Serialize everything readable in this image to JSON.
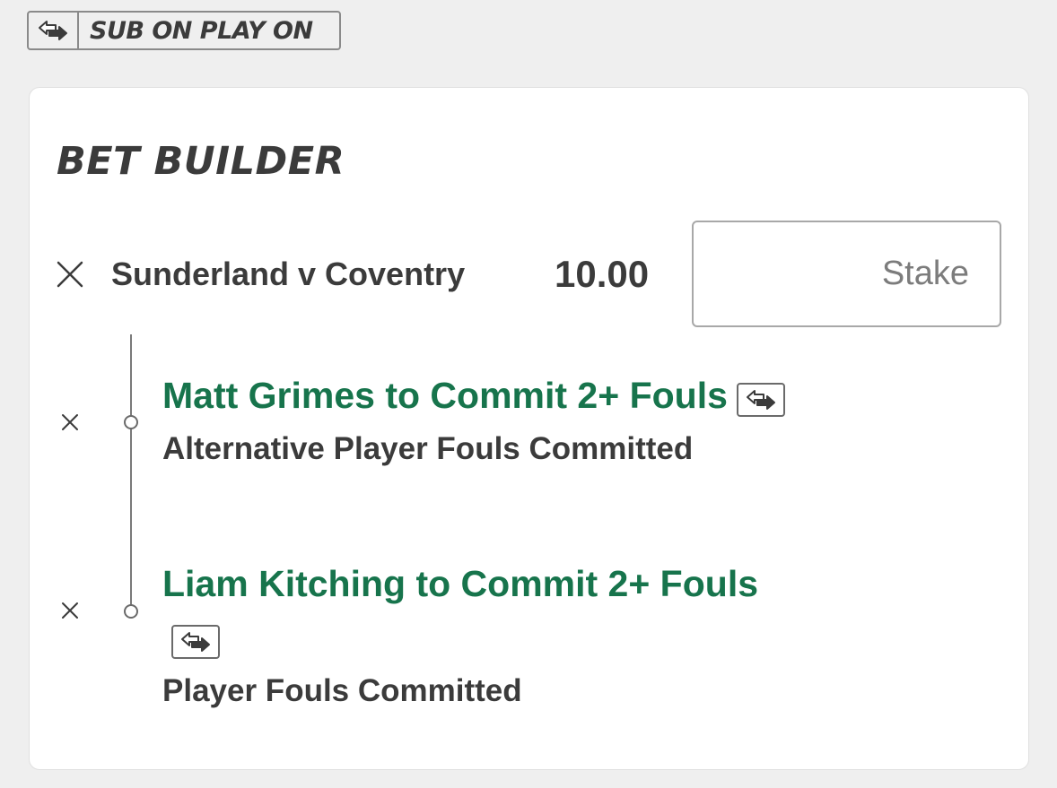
{
  "sub_on_badge": {
    "icon": "sub-swap-icon",
    "label": "SUB ON PLAY ON"
  },
  "bet_builder": {
    "title": "BET BUILDER",
    "match": "Sunderland v Coventry",
    "odds": "10.00",
    "stake": {
      "placeholder": "Stake",
      "value": ""
    },
    "selections": [
      {
        "name": "Matt Grimes to Commit 2+ Fouls",
        "market": "Alternative Player Fouls Committed",
        "icon": "sub-swap-icon"
      },
      {
        "name": "Liam Kitching to Commit 2+ Fouls",
        "market": "Player Fouls Committed",
        "icon": "sub-swap-icon"
      }
    ]
  },
  "colors": {
    "selection_green": "#17744c",
    "text_dark": "#3b3b3b",
    "background": "#efefef",
    "card": "#ffffff"
  }
}
